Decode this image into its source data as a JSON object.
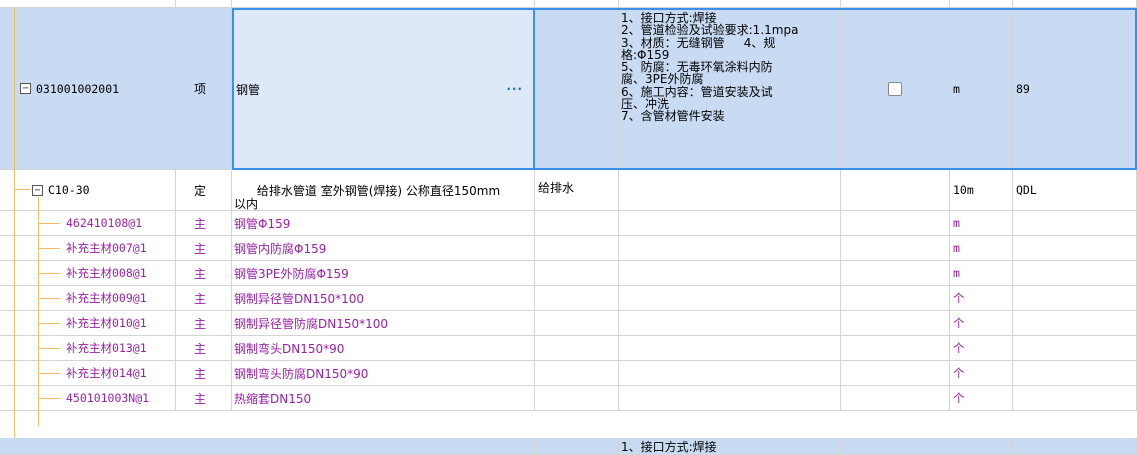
{
  "rows": {
    "main": {
      "code": "031001002001",
      "type": "项",
      "name": "钢管",
      "name_more": "···",
      "features": "1、接口方式:焊接\n2、管道检验及试验要求:1.1mpa\n3、材质：无缝钢管     4、规\n格:Φ159\n5、防腐：无毒环氧涂料内防\n腐、3PE外防腐\n6、施工内容：管道安装及试\n压、冲洗\n7、含管材管件安装",
      "unit": "m",
      "qty": "89"
    },
    "quota": {
      "code": "C10-30",
      "type": "定",
      "name": "给排水管道 室外钢管(焊接) 公称直径150mm\n以内",
      "specialty": "给排水",
      "unit": "10m",
      "qty": "QDL"
    },
    "materials": [
      {
        "code": "462410108@1",
        "type": "主",
        "name": "钢管Φ159",
        "unit": "m"
      },
      {
        "code": "补充主材007@1",
        "type": "主",
        "name": "钢管内防腐Φ159",
        "unit": "m"
      },
      {
        "code": "补充主材008@1",
        "type": "主",
        "name": "钢管3PE外防腐Φ159",
        "unit": "m"
      },
      {
        "code": "补充主材009@1",
        "type": "主",
        "name": "钢制异径管DN150*100",
        "unit": "个"
      },
      {
        "code": "补充主材010@1",
        "type": "主",
        "name": "钢制异径管防腐DN150*100",
        "unit": "个"
      },
      {
        "code": "补充主材013@1",
        "type": "主",
        "name": "钢制弯头DN150*90",
        "unit": "个"
      },
      {
        "code": "补充主材014@1",
        "type": "主",
        "name": "钢制弯头防腐DN150*90",
        "unit": "个"
      },
      {
        "code": "450101003N@1",
        "type": "主",
        "name": "热缩套DN150",
        "unit": "个"
      }
    ],
    "next": {
      "features": "1、接口方式:焊接"
    }
  },
  "colors": {
    "selection": "#c9dbf3",
    "focus_border": "#3d8ee8",
    "material_text": "#9b1fa8",
    "tree_line": "#f0c060"
  }
}
